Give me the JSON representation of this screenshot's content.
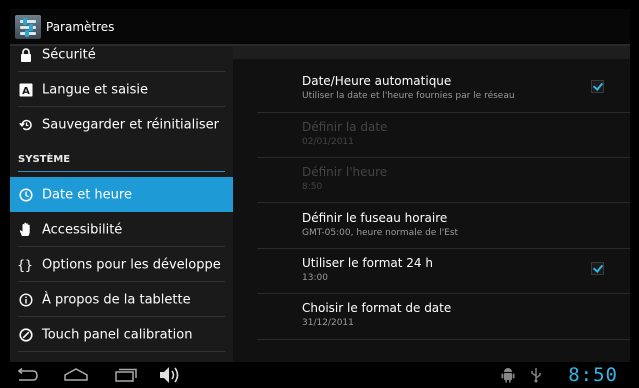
{
  "app": {
    "title": "Paramètres"
  },
  "sidebar": {
    "items": [
      {
        "id": "security",
        "label": "Sécurité",
        "icon": "lock-icon"
      },
      {
        "id": "language",
        "label": "Langue et saisie",
        "icon": "keyboard-a-icon"
      },
      {
        "id": "backup",
        "label": "Sauvegarder et réinitialiser",
        "icon": "restore-icon"
      },
      {
        "id": "datetime",
        "label": "Date et heure",
        "icon": "clock-icon",
        "active": true
      },
      {
        "id": "accessibility",
        "label": "Accessibilité",
        "icon": "hand-icon"
      },
      {
        "id": "devoptions",
        "label": "Options pour les développe",
        "icon": "braces-icon"
      },
      {
        "id": "about",
        "label": "À propos de la tablette",
        "icon": "info-icon"
      },
      {
        "id": "calibration",
        "label": "Touch panel calibration",
        "icon": "calibration-icon"
      }
    ],
    "section_system": "SYSTÈME"
  },
  "settings": {
    "auto_datetime": {
      "title": "Date/Heure automatique",
      "summary": "Utiliser la date et l'heure fournies par le réseau",
      "checked": true
    },
    "set_date": {
      "title": "Définir la date",
      "summary": "02/01/2011",
      "enabled": false
    },
    "set_time": {
      "title": "Définir l'heure",
      "summary": "8:50",
      "enabled": false
    },
    "timezone": {
      "title": "Définir le fuseau horaire",
      "summary": "GMT-05:00, heure normale de l'Est"
    },
    "format24": {
      "title": "Utiliser le format 24 h",
      "summary": "13:00",
      "checked": true
    },
    "date_format": {
      "title": "Choisir le format de date",
      "summary": "31/12/2011"
    }
  },
  "statusbar": {
    "clock": "8:50"
  },
  "colors": {
    "accent": "#33b5e5",
    "active_item": "#1e9ad6"
  }
}
